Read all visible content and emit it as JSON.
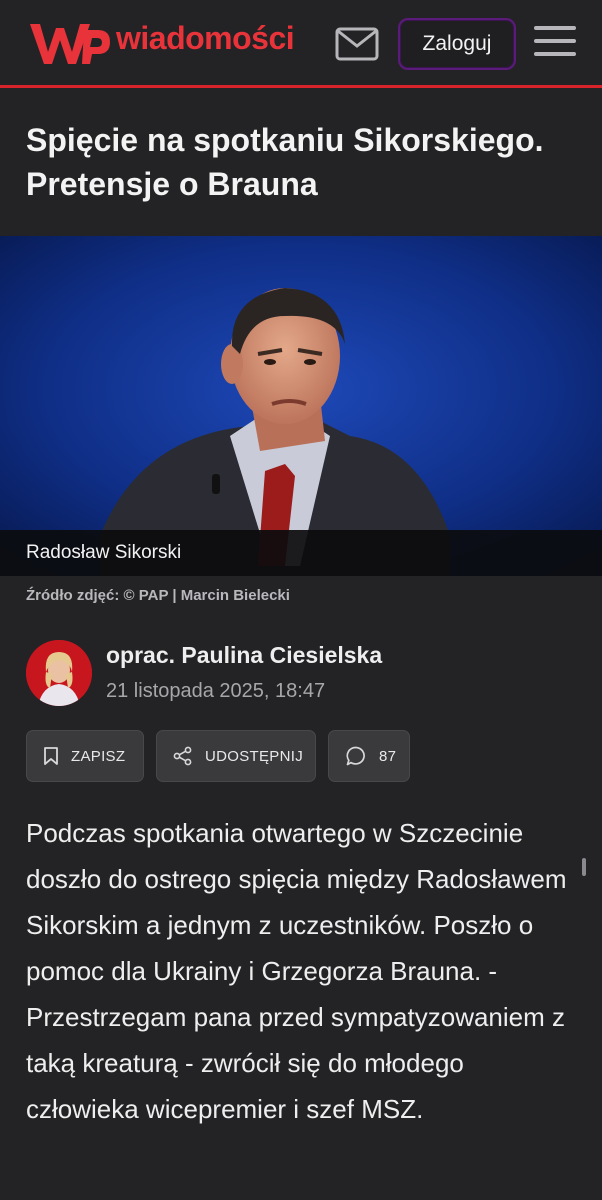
{
  "header": {
    "logo_text": "wiadomości",
    "login_label": "Zaloguj",
    "brand_color": "#e8333a",
    "icons": [
      "wp-logo-icon",
      "mail-icon",
      "hamburger-menu-icon"
    ]
  },
  "article": {
    "title": "Spięcie na spotkaniu Sikorskiego. Pretensje o Brauna",
    "photo_caption": "Radosław Sikorski",
    "photo_source": "Źródło zdjęć: © PAP | Marcin Bielecki",
    "author": "oprac. Paulina Ciesielska",
    "date": "21 listopada 2025, 18:47",
    "lead": "Podczas spotkania otwartego w Szczecinie doszło do ostrego spięcia między Radosławem Sikorskim a jednym z uczestników. Poszło o pomoc dla Ukrainy i Grzegorza Brauna. - Przestrzegam pana przed sympatyzowaniem z taką kreaturą - zwrócił się do młodego człowieka wicepremier i szef MSZ."
  },
  "actions": {
    "save_label": "ZAPISZ",
    "share_label": "UDOSTĘPNIJ",
    "comments_count": "87",
    "icons": [
      "bookmark-icon",
      "share-icon",
      "comment-icon"
    ]
  }
}
